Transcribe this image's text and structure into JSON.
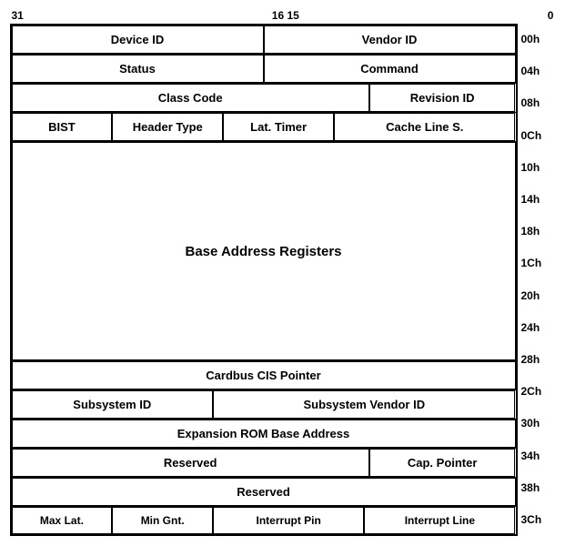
{
  "bits": {
    "b31": "31",
    "b16": "16",
    "b15": "15",
    "b0": "0"
  },
  "rows": [
    {
      "addr": "00h",
      "cells": [
        {
          "label": "Device ID",
          "colspan": 1,
          "width": "50%"
        },
        {
          "label": "Vendor ID",
          "colspan": 1,
          "width": "50%"
        }
      ]
    },
    {
      "addr": "04h",
      "cells": [
        {
          "label": "Status",
          "colspan": 1,
          "width": "50%"
        },
        {
          "label": "Command",
          "colspan": 1,
          "width": "50%"
        }
      ]
    },
    {
      "addr": "08h",
      "cells": [
        {
          "label": "Class Code",
          "colspan": 1,
          "width": "71%"
        },
        {
          "label": "Revision ID",
          "colspan": 1,
          "width": "29%"
        }
      ]
    },
    {
      "addr": "0Ch",
      "cells": [
        {
          "label": "BIST",
          "width": "20%"
        },
        {
          "label": "Header Type",
          "width": "22%"
        },
        {
          "label": "Lat. Timer",
          "width": "22%"
        },
        {
          "label": "Cache Line S.",
          "width": "36%"
        }
      ]
    },
    {
      "addr": "10h",
      "spacer": true
    },
    {
      "addr": "14h",
      "spacer": true
    },
    {
      "addr": "18h",
      "spacer": true
    },
    {
      "addr": "1Ch",
      "spacer": true,
      "mid": true
    },
    {
      "addr": "20h",
      "spacer": true
    },
    {
      "addr": "24h",
      "spacer": true,
      "last": true
    },
    {
      "addr": "28h",
      "cells": [
        {
          "label": "Cardbus CIS Pointer",
          "width": "100%"
        }
      ]
    },
    {
      "addr": "2Ch",
      "cells": [
        {
          "label": "Subsystem ID",
          "width": "40%"
        },
        {
          "label": "Subsystem Vendor ID",
          "width": "60%"
        }
      ]
    },
    {
      "addr": "30h",
      "cells": [
        {
          "label": "Expansion ROM Base Address",
          "width": "100%"
        }
      ]
    },
    {
      "addr": "34h",
      "cells": [
        {
          "label": "Reserved",
          "width": "71%"
        },
        {
          "label": "Cap. Pointer",
          "width": "29%"
        }
      ]
    },
    {
      "addr": "38h",
      "cells": [
        {
          "label": "Reserved",
          "width": "100%"
        }
      ]
    },
    {
      "addr": "3Ch",
      "cells": [
        {
          "label": "Max Lat.",
          "width": "20%"
        },
        {
          "label": "Min Gnt.",
          "width": "22%"
        },
        {
          "label": "Interrupt Pin",
          "width": "29%"
        },
        {
          "label": "Interrupt Line",
          "width": "29%"
        }
      ]
    }
  ]
}
